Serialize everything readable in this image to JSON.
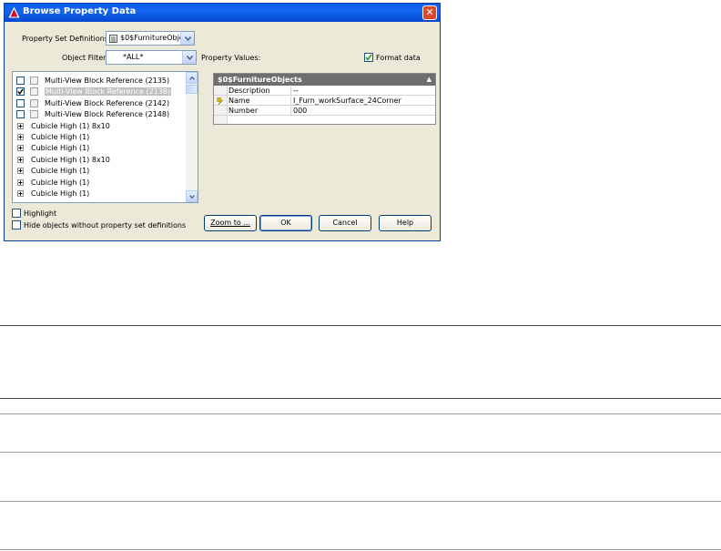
{
  "dialog": {
    "title": "Browse Property Data",
    "close_symbol": "✕",
    "icon": "autocad-logo-icon"
  },
  "fields": {
    "psd_label": "Property Set Definitions:",
    "psd_value": "$0$FurnitureObje",
    "filter_label": "Object Filter:",
    "filter_value": "*ALL*",
    "values_label": "Property Values:",
    "format_label": "Format data",
    "format_checked": true
  },
  "object_list": {
    "items": [
      {
        "type": "check",
        "label": "Multi-View Block Reference (2135)",
        "checked": false,
        "selected": false
      },
      {
        "type": "check",
        "label": "Multi-View Block Reference (2138)",
        "checked": true,
        "selected": true
      },
      {
        "type": "check",
        "label": "Multi-View Block Reference (2142)",
        "checked": false,
        "selected": false
      },
      {
        "type": "check",
        "label": "Multi-View Block Reference (2148)",
        "checked": false,
        "selected": false
      },
      {
        "type": "tree",
        "label": "Cubicle High (1) 8x10"
      },
      {
        "type": "tree",
        "label": "Cubicle High (1)"
      },
      {
        "type": "tree",
        "label": "Cubicle High (1)"
      },
      {
        "type": "tree",
        "label": "Cubicle High (1) 8x10"
      },
      {
        "type": "tree",
        "label": "Cubicle High (1)"
      },
      {
        "type": "tree",
        "label": "Cubicle High (1)"
      },
      {
        "type": "tree",
        "label": "Cubicle High (1)"
      }
    ]
  },
  "property_grid": {
    "header": "$0$FurnitureObjects",
    "collapse_symbol": "▲",
    "rows": [
      {
        "key": "Description",
        "value": "--"
      },
      {
        "key": "Name",
        "value": "I_Furn_workSurface_24Corner"
      },
      {
        "key": "Number",
        "value": "000"
      }
    ]
  },
  "options": {
    "highlight_label": "Highlight",
    "hide_label": "Hide objects without property set definitions"
  },
  "buttons": {
    "zoom": "Zoom to ...",
    "ok": "OK",
    "cancel": "Cancel",
    "help": "Help"
  },
  "colors": {
    "titlebar": "#0a5ce9",
    "dialog_bg": "#ece9d8",
    "grid_header": "#6e6e6e"
  }
}
